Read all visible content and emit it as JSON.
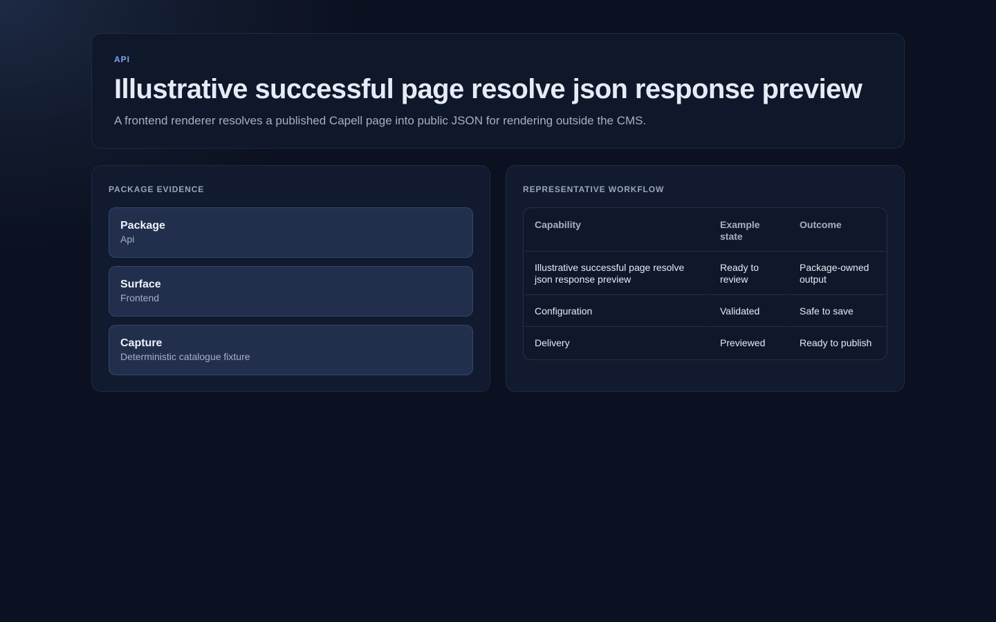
{
  "hero": {
    "eyebrow": "API",
    "title": "Illustrative successful page resolve json response preview",
    "subtitle": "A frontend renderer resolves a published Capell page into public JSON for rendering outside the CMS."
  },
  "evidence": {
    "title": "PACKAGE EVIDENCE",
    "items": [
      {
        "label": "Package",
        "value": "Api"
      },
      {
        "label": "Surface",
        "value": "Frontend"
      },
      {
        "label": "Capture",
        "value": "Deterministic catalogue fixture"
      }
    ]
  },
  "workflow": {
    "title": "REPRESENTATIVE WORKFLOW",
    "columns": [
      "Capability",
      "Example state",
      "Outcome"
    ],
    "rows": [
      [
        "Illustrative successful page resolve json response preview",
        "Ready to review",
        "Package-owned output"
      ],
      [
        "Configuration",
        "Validated",
        "Safe to save"
      ],
      [
        "Delivery",
        "Previewed",
        "Ready to publish"
      ]
    ]
  },
  "colors": {
    "background": "#0b1120",
    "card": "#0f172a",
    "accent": "#7ea6f4"
  }
}
